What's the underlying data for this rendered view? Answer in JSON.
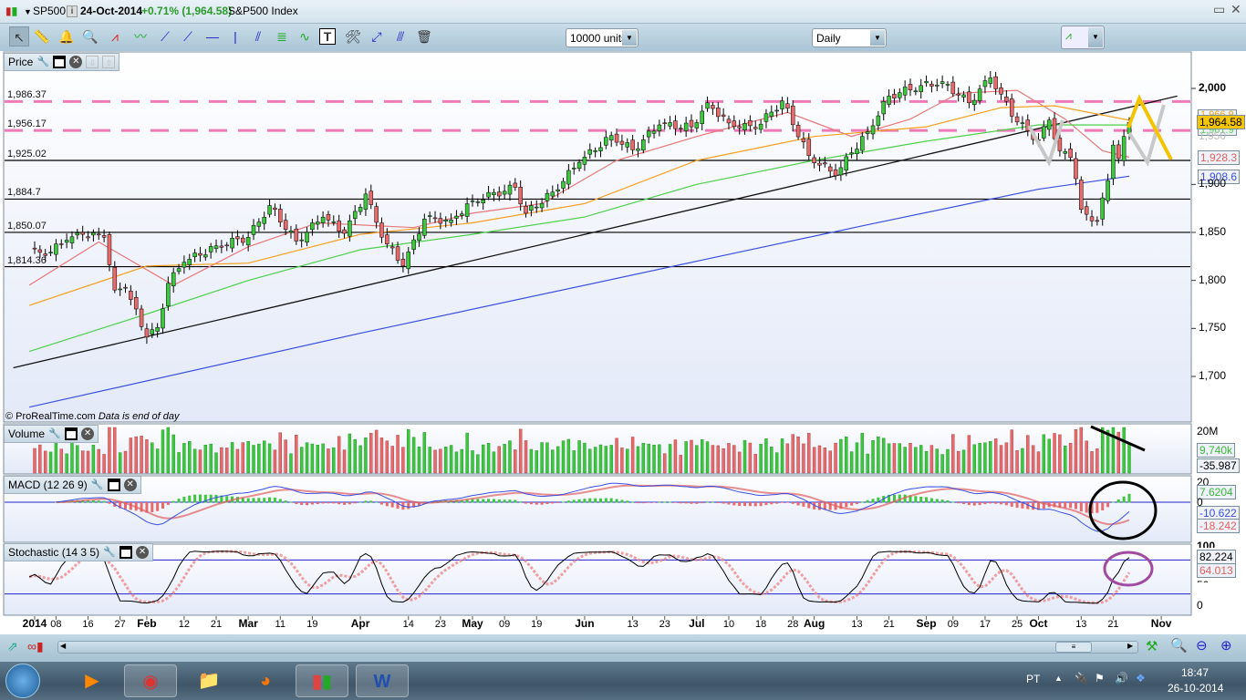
{
  "title_bar": {
    "symbol": "SP500",
    "date": "24-Oct-2014",
    "change": "+0.71% (1,964.58)",
    "name": "S&P500 Index",
    "info_icon": "i"
  },
  "toolbar": {
    "units": "10000 units",
    "period": "Daily",
    "tools": [
      "pointer",
      "ruler",
      "alert-bell",
      "zoom-magnifier",
      "triangle",
      "channel",
      "segment",
      "line",
      "horizontal-line",
      "vertical-line",
      "fibonacci-fan",
      "fibonacci-retracement",
      "trend-channel",
      "text",
      "settings-tools",
      "move-points",
      "parallel",
      "trash"
    ]
  },
  "panels": {
    "price": {
      "label": "Price",
      "copyright": "© ProRealTime.com",
      "note": "Data is end of day"
    },
    "volume": {
      "label": "Volume"
    },
    "macd": {
      "label": "MACD (12 26 9)"
    },
    "stochastic": {
      "label": "Stochastic (14 3 5)"
    }
  },
  "chart_data": {
    "type": "candlestick",
    "title": "SP500 Daily",
    "ylim": [
      1660,
      2030
    ],
    "yticks": [
      "2,000",
      "1,900",
      "1,850",
      "1,800",
      "1,750",
      "1,700"
    ],
    "ytick_values": [
      2000,
      1900,
      1850,
      1800,
      1750,
      1700
    ],
    "hidden_ytick_labels": [
      "1,950"
    ],
    "last_price": "1,964.58",
    "ma_last_labels": [
      "1,966.9",
      "1,961.9",
      "1,928.3",
      "1,908.6"
    ],
    "hlines": [
      {
        "value": 1986.37,
        "label": "1,986.37",
        "style": "dashed",
        "color": "#f07ab8"
      },
      {
        "value": 1956.17,
        "label": "1,956.17",
        "style": "dashed",
        "color": "#f07ab8"
      },
      {
        "value": 1925.02,
        "label": "1,925.02",
        "style": "solid",
        "color": "#000000"
      },
      {
        "value": 1884.7,
        "label": "1,884.7",
        "style": "solid",
        "color": "#000000"
      },
      {
        "value": 1850.07,
        "label": "1,850.07",
        "style": "solid",
        "color": "#000000"
      },
      {
        "value": 1814.36,
        "label": "1,814.36",
        "style": "solid",
        "color": "#000000"
      }
    ],
    "trendline": [
      [
        "2013-12-26",
        1709
      ],
      [
        "2014-11-06",
        1992
      ]
    ],
    "closes": [
      [
        "2013-12-31",
        1831
      ],
      [
        "2014-01-06",
        1826
      ],
      [
        "2014-01-10",
        1842
      ],
      [
        "2014-01-15",
        1848
      ],
      [
        "2014-01-22",
        1845
      ],
      [
        "2014-01-24",
        1790
      ],
      [
        "2014-01-28",
        1792
      ],
      [
        "2014-02-03",
        1741
      ],
      [
        "2014-02-05",
        1751
      ],
      [
        "2014-02-07",
        1797
      ],
      [
        "2014-02-12",
        1819
      ],
      [
        "2014-02-21",
        1836
      ],
      [
        "2014-03-03",
        1845
      ],
      [
        "2014-03-07",
        1878
      ],
      [
        "2014-03-14",
        1841
      ],
      [
        "2014-03-21",
        1866
      ],
      [
        "2014-03-27",
        1849
      ],
      [
        "2014-04-02",
        1890
      ],
      [
        "2014-04-07",
        1845
      ],
      [
        "2014-04-11",
        1815
      ],
      [
        "2014-04-17",
        1864
      ],
      [
        "2014-04-25",
        1863
      ],
      [
        "2014-05-01",
        1883
      ],
      [
        "2014-05-13",
        1897
      ],
      [
        "2014-05-15",
        1870
      ],
      [
        "2014-05-22",
        1892
      ],
      [
        "2014-05-30",
        1923
      ],
      [
        "2014-06-09",
        1951
      ],
      [
        "2014-06-13",
        1936
      ],
      [
        "2014-06-20",
        1962
      ],
      [
        "2014-06-30",
        1960
      ],
      [
        "2014-07-03",
        1985
      ],
      [
        "2014-07-10",
        1964
      ],
      [
        "2014-07-17",
        1958
      ],
      [
        "2014-07-24",
        1987
      ],
      [
        "2014-07-31",
        1930
      ],
      [
        "2014-08-07",
        1909
      ],
      [
        "2014-08-12",
        1933
      ],
      [
        "2014-08-15",
        1955
      ],
      [
        "2014-08-21",
        1992
      ],
      [
        "2014-08-29",
        2003
      ],
      [
        "2014-09-05",
        2007
      ],
      [
        "2014-09-12",
        1985
      ],
      [
        "2014-09-18",
        2011
      ],
      [
        "2014-09-22",
        1994
      ],
      [
        "2014-09-25",
        1965
      ],
      [
        "2014-10-01",
        1946
      ],
      [
        "2014-10-03",
        1967
      ],
      [
        "2014-10-07",
        1935
      ],
      [
        "2014-10-09",
        1928
      ],
      [
        "2014-10-10",
        1906
      ],
      [
        "2014-10-13",
        1874
      ],
      [
        "2014-10-15",
        1862
      ],
      [
        "2014-10-16",
        1862
      ],
      [
        "2014-10-17",
        1886
      ],
      [
        "2014-10-20",
        1904
      ],
      [
        "2014-10-21",
        1941
      ],
      [
        "2014-10-22",
        1927
      ],
      [
        "2014-10-23",
        1950
      ],
      [
        "2014-10-24",
        1964.58
      ]
    ],
    "moving_averages": [
      {
        "name": "MA20",
        "color": "#e87878",
        "last": "1,928.3",
        "points": [
          [
            "2013-12-31",
            1795
          ],
          [
            "2014-01-20",
            1840
          ],
          [
            "2014-02-10",
            1795
          ],
          [
            "2014-03-01",
            1835
          ],
          [
            "2014-03-20",
            1860
          ],
          [
            "2014-04-15",
            1855
          ],
          [
            "2014-05-01",
            1870
          ],
          [
            "2014-05-20",
            1880
          ],
          [
            "2014-06-10",
            1925
          ],
          [
            "2014-07-01",
            1950
          ],
          [
            "2014-07-25",
            1975
          ],
          [
            "2014-08-12",
            1950
          ],
          [
            "2014-08-27",
            1968
          ],
          [
            "2014-09-10",
            1995
          ],
          [
            "2014-09-25",
            1998
          ],
          [
            "2014-10-08",
            1968
          ],
          [
            "2014-10-17",
            1935
          ],
          [
            "2014-10-24",
            1928.3
          ]
        ]
      },
      {
        "name": "MA50",
        "color": "#f5a020",
        "last": "1,966.9",
        "points": [
          [
            "2013-12-31",
            1774
          ],
          [
            "2014-02-01",
            1815
          ],
          [
            "2014-03-01",
            1818
          ],
          [
            "2014-04-01",
            1848
          ],
          [
            "2014-05-01",
            1860
          ],
          [
            "2014-06-01",
            1880
          ],
          [
            "2014-07-01",
            1925
          ],
          [
            "2014-08-01",
            1950
          ],
          [
            "2014-09-01",
            1960
          ],
          [
            "2014-09-20",
            1980
          ],
          [
            "2014-10-05",
            1982
          ],
          [
            "2014-10-24",
            1966.9
          ]
        ]
      },
      {
        "name": "MA100",
        "color": "#4ed04e",
        "last": "1,961.9",
        "points": [
          [
            "2013-12-31",
            1726
          ],
          [
            "2014-02-01",
            1765
          ],
          [
            "2014-03-01",
            1800
          ],
          [
            "2014-04-01",
            1832
          ],
          [
            "2014-05-01",
            1848
          ],
          [
            "2014-06-01",
            1866
          ],
          [
            "2014-07-01",
            1900
          ],
          [
            "2014-08-01",
            1925
          ],
          [
            "2014-09-01",
            1945
          ],
          [
            "2014-10-01",
            1962
          ],
          [
            "2014-10-24",
            1961.9
          ]
        ]
      },
      {
        "name": "MA200",
        "color": "#3a4fe0",
        "last": "1,908.6",
        "points": [
          [
            "2013-12-31",
            1668
          ],
          [
            "2014-04-01",
            1745
          ],
          [
            "2014-07-01",
            1820
          ],
          [
            "2014-08-15",
            1858
          ],
          [
            "2014-10-01",
            1895
          ],
          [
            "2014-10-24",
            1908.6
          ]
        ]
      }
    ],
    "volume": {
      "ytick": "20M",
      "last": "9,740k"
    },
    "macd": {
      "params": "12 26 9",
      "yticks": [
        "20",
        "0"
      ],
      "values": {
        "histogram": "7.6204",
        "macd": "-10.622",
        "signal": "-18.242"
      },
      "extra": "-35.987"
    },
    "stochastic": {
      "params": "14 3 5",
      "yticks": [
        "100",
        "0"
      ],
      "hidden_ytick": "50",
      "values": {
        "k": "82.224",
        "d": "64.013"
      },
      "levels": [
        80,
        20
      ]
    },
    "xaxis": [
      [
        "2014",
        "2014-01-02",
        true
      ],
      [
        "08",
        "2014-01-08",
        false
      ],
      [
        "16",
        "2014-01-16",
        false
      ],
      [
        "27",
        "2014-01-27",
        false
      ],
      [
        "Feb",
        "2014-02-03",
        true
      ],
      [
        "12",
        "2014-02-12",
        false
      ],
      [
        "21",
        "2014-02-21",
        false
      ],
      [
        "Mar",
        "2014-03-03",
        true
      ],
      [
        "11",
        "2014-03-11",
        false
      ],
      [
        "19",
        "2014-03-19",
        false
      ],
      [
        "Apr",
        "2014-04-01",
        true
      ],
      [
        "14",
        "2014-04-14",
        false
      ],
      [
        "23",
        "2014-04-23",
        false
      ],
      [
        "May",
        "2014-05-01",
        true
      ],
      [
        "09",
        "2014-05-09",
        false
      ],
      [
        "19",
        "2014-05-19",
        false
      ],
      [
        "Jun",
        "2014-06-02",
        true
      ],
      [
        "13",
        "2014-06-13",
        false
      ],
      [
        "23",
        "2014-06-23",
        false
      ],
      [
        "Jul",
        "2014-07-01",
        true
      ],
      [
        "10",
        "2014-07-10",
        false
      ],
      [
        "18",
        "2014-07-18",
        false
      ],
      [
        "28",
        "2014-07-28",
        false
      ],
      [
        "Aug",
        "2014-08-01",
        true
      ],
      [
        "13",
        "2014-08-13",
        false
      ],
      [
        "21",
        "2014-08-21",
        false
      ],
      [
        "Sep",
        "2014-09-02",
        true
      ],
      [
        "09",
        "2014-09-09",
        false
      ],
      [
        "17",
        "2014-09-17",
        false
      ],
      [
        "25",
        "2014-09-25",
        false
      ],
      [
        "Oct",
        "2014-10-01",
        true
      ],
      [
        "13",
        "2014-10-13",
        false
      ],
      [
        "21",
        "2014-10-21",
        false
      ],
      [
        "Nov",
        "2014-11-03",
        true
      ]
    ]
  },
  "taskbar": {
    "language": "PT",
    "time": "18:47",
    "date": "26-10-2014",
    "apps": [
      "media-center",
      "chrome",
      "file-explorer",
      "firefox",
      "prorealtime",
      "word"
    ]
  }
}
